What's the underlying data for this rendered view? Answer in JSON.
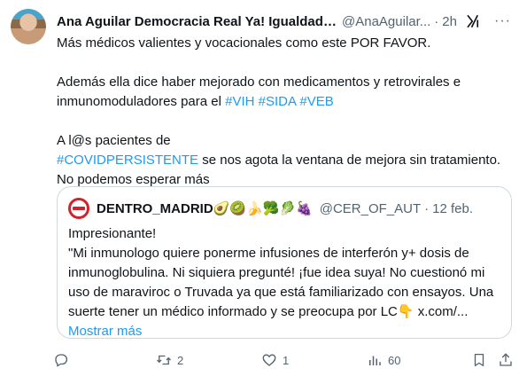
{
  "author": {
    "display_name": "Ana Aguilar Democracia Real Ya! Igualdad R...",
    "handle": "@AnaAguilar...",
    "separator": "·",
    "time": "2h"
  },
  "post": {
    "line1": "Más médicos valientes y vocacionales como este POR FAVOR.",
    "para2": {
      "text_a": "Además ella dice haber mejorado con medicamentos y retrovirales e inmunomoduladores para el ",
      "hashtags": [
        "#VIH",
        "#SIDA",
        "#VEB"
      ]
    },
    "para3": {
      "text_a": " A l@s pacientes de",
      "hashtag": "#COVIDPERSISTENTE",
      "text_b": " se nos agota la ventana de mejora sin tratamiento. No podemos esperar más"
    }
  },
  "quote": {
    "name": "DENTRO_MADRID",
    "emoji": "🥑🥝🍌🥦🥬🍇",
    "handle": "@CER_OF_AUT",
    "separator": "·",
    "date": "12 feb.",
    "line1": "Impresionante!",
    "text": "\"Mi inmunologo quiere ponerme infusiones de interferón y+ dosis de inmunoglobulina. Ni siquiera pregunté! ¡fue idea suya! No cuestionó mi uso de maraviroc o Truvada  ya que está familiarizado con ensayos. Una suerte tener un médico  informado y se preocupa por LC👇 x.com/...",
    "show_more": "Mostrar más"
  },
  "actions": {
    "replies": "",
    "reposts": "2",
    "likes": "1",
    "views": "60"
  },
  "colors": {
    "accent": "#1d9bf0",
    "secondary_text": "#536471",
    "border": "#cfd9de",
    "quote_avatar_red": "#d4212b"
  },
  "icons": [
    "grok-icon",
    "more-icon",
    "reply-icon",
    "repost-icon",
    "like-icon",
    "views-icon",
    "bookmark-icon",
    "share-icon"
  ]
}
